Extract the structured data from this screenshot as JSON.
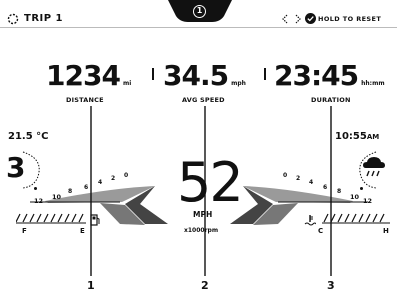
{
  "header": {
    "trip_label": "TRIP 1",
    "page_number": "1",
    "hold_to_reset": "HOLD TO RESET"
  },
  "stats": {
    "distance": {
      "value": "1234",
      "unit": "mi",
      "label": "DISTANCE"
    },
    "avg_speed": {
      "value": "34.5",
      "unit": "mph",
      "label": "AVG SPEED"
    },
    "duration": {
      "value": "23:45",
      "unit": "hh:mm",
      "label": "DURATION"
    }
  },
  "environment": {
    "temperature": "21.5 °C",
    "time": "10:55",
    "time_suffix": "AM",
    "weather_icon": "cloud-rain-icon"
  },
  "gear": "3",
  "speed": {
    "value": "52",
    "unit": "MPH"
  },
  "rpm": {
    "unit": "x1000rpm",
    "left_ticks": [
      "12",
      "10",
      "8",
      "6",
      "4",
      "2",
      "0"
    ],
    "right_ticks": [
      "0",
      "2",
      "4",
      "6",
      "8",
      "10",
      "12"
    ]
  },
  "fuel": {
    "full": "F",
    "empty": "E",
    "icon": "fuel-pump-icon"
  },
  "coolant": {
    "cold": "C",
    "hot": "H",
    "icon": "coolant-temp-icon"
  },
  "annotations": [
    "1",
    "2",
    "3"
  ]
}
